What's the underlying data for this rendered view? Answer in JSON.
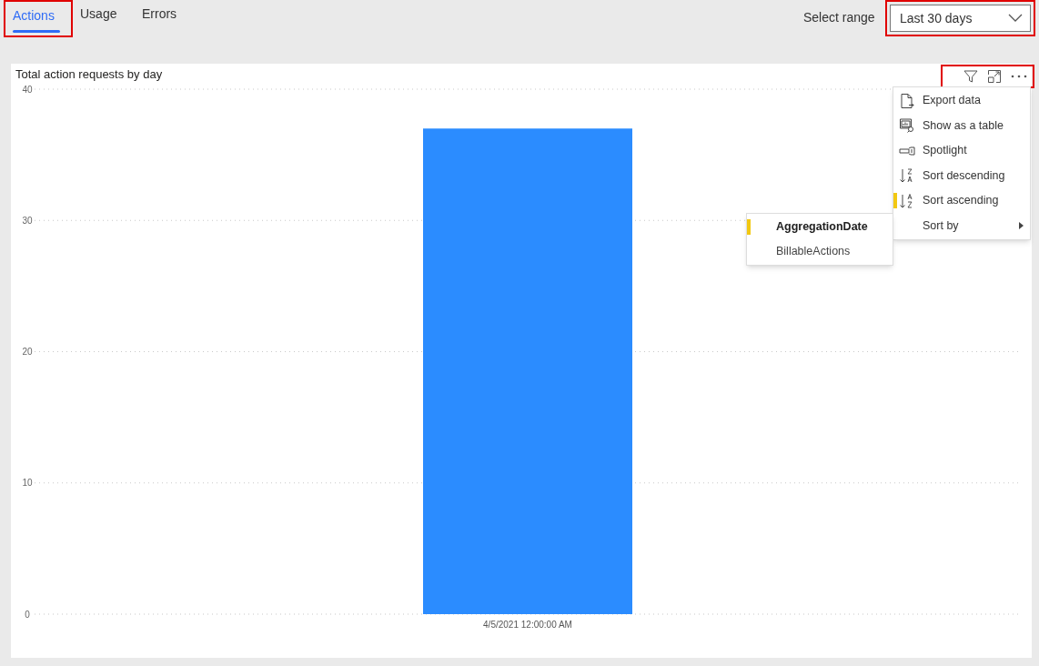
{
  "tabs": [
    {
      "label": "Actions",
      "selected": true,
      "highlighted": true
    },
    {
      "label": "Usage",
      "selected": false,
      "highlighted": false
    },
    {
      "label": "Errors",
      "selected": false,
      "highlighted": false
    }
  ],
  "range": {
    "label": "Select range",
    "value": "Last 30 days",
    "highlighted": true
  },
  "visual": {
    "title": "Total action requests by day",
    "toolbar_highlighted": true,
    "chart_data": {
      "type": "bar",
      "categories": [
        "4/5/2021 12:00:00 AM"
      ],
      "series": [
        {
          "color": "#2b8cff",
          "values": [
            37
          ]
        }
      ],
      "grid": true,
      "ylim": [
        0,
        40
      ],
      "yticks": [
        0,
        10,
        20,
        30,
        40
      ]
    }
  },
  "menu": {
    "items": [
      {
        "kind": "export",
        "label": "Export data",
        "selected": false
      },
      {
        "kind": "table",
        "label": "Show as a table",
        "selected": false
      },
      {
        "kind": "spotlight",
        "label": "Spotlight",
        "selected": false
      },
      {
        "kind": "sortdesc",
        "label": "Sort descending",
        "selected": false
      },
      {
        "kind": "sortasc",
        "label": "Sort ascending",
        "selected": true
      },
      {
        "kind": "submenu",
        "label": "Sort by",
        "selected": false
      }
    ],
    "submenu": [
      {
        "label": "AggregationDate",
        "selected": true
      },
      {
        "label": "BillableActions",
        "selected": false
      }
    ]
  }
}
